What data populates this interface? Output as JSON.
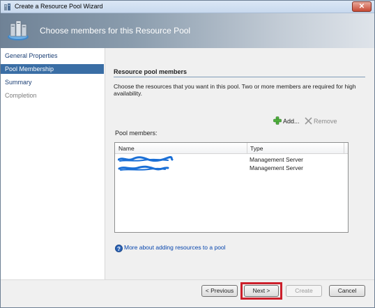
{
  "window": {
    "title": "Create a Resource Pool Wizard",
    "close_glyph": "✕"
  },
  "banner": {
    "title": "Choose members for this Resource Pool",
    "icon": "server-pool-icon"
  },
  "nav": {
    "items": [
      {
        "label": "General Properties",
        "state": "normal"
      },
      {
        "label": "Pool Membership",
        "state": "selected"
      },
      {
        "label": "Summary",
        "state": "normal"
      },
      {
        "label": "Completion",
        "state": "disabled"
      }
    ]
  },
  "content": {
    "section_title": "Resource pool members",
    "description": "Choose the resources that you want in this pool. Two or more members are required for high availability.",
    "add_label": "Add...",
    "remove_label": "Remove",
    "members_label": "Pool members:",
    "columns": [
      "Name",
      "Type"
    ],
    "rows": [
      {
        "name": "",
        "type": "Management Server"
      },
      {
        "name": "",
        "type": "Management Server"
      }
    ],
    "help_link": "More about adding resources to a pool",
    "help_glyph": "?"
  },
  "footer": {
    "previous_label": "< Previous",
    "next_label": "Next >",
    "create_label": "Create",
    "cancel_label": "Cancel"
  },
  "colors": {
    "selected_nav": "#3a6ea5",
    "highlight_border": "#cc1f2b",
    "link": "#0645ad"
  }
}
